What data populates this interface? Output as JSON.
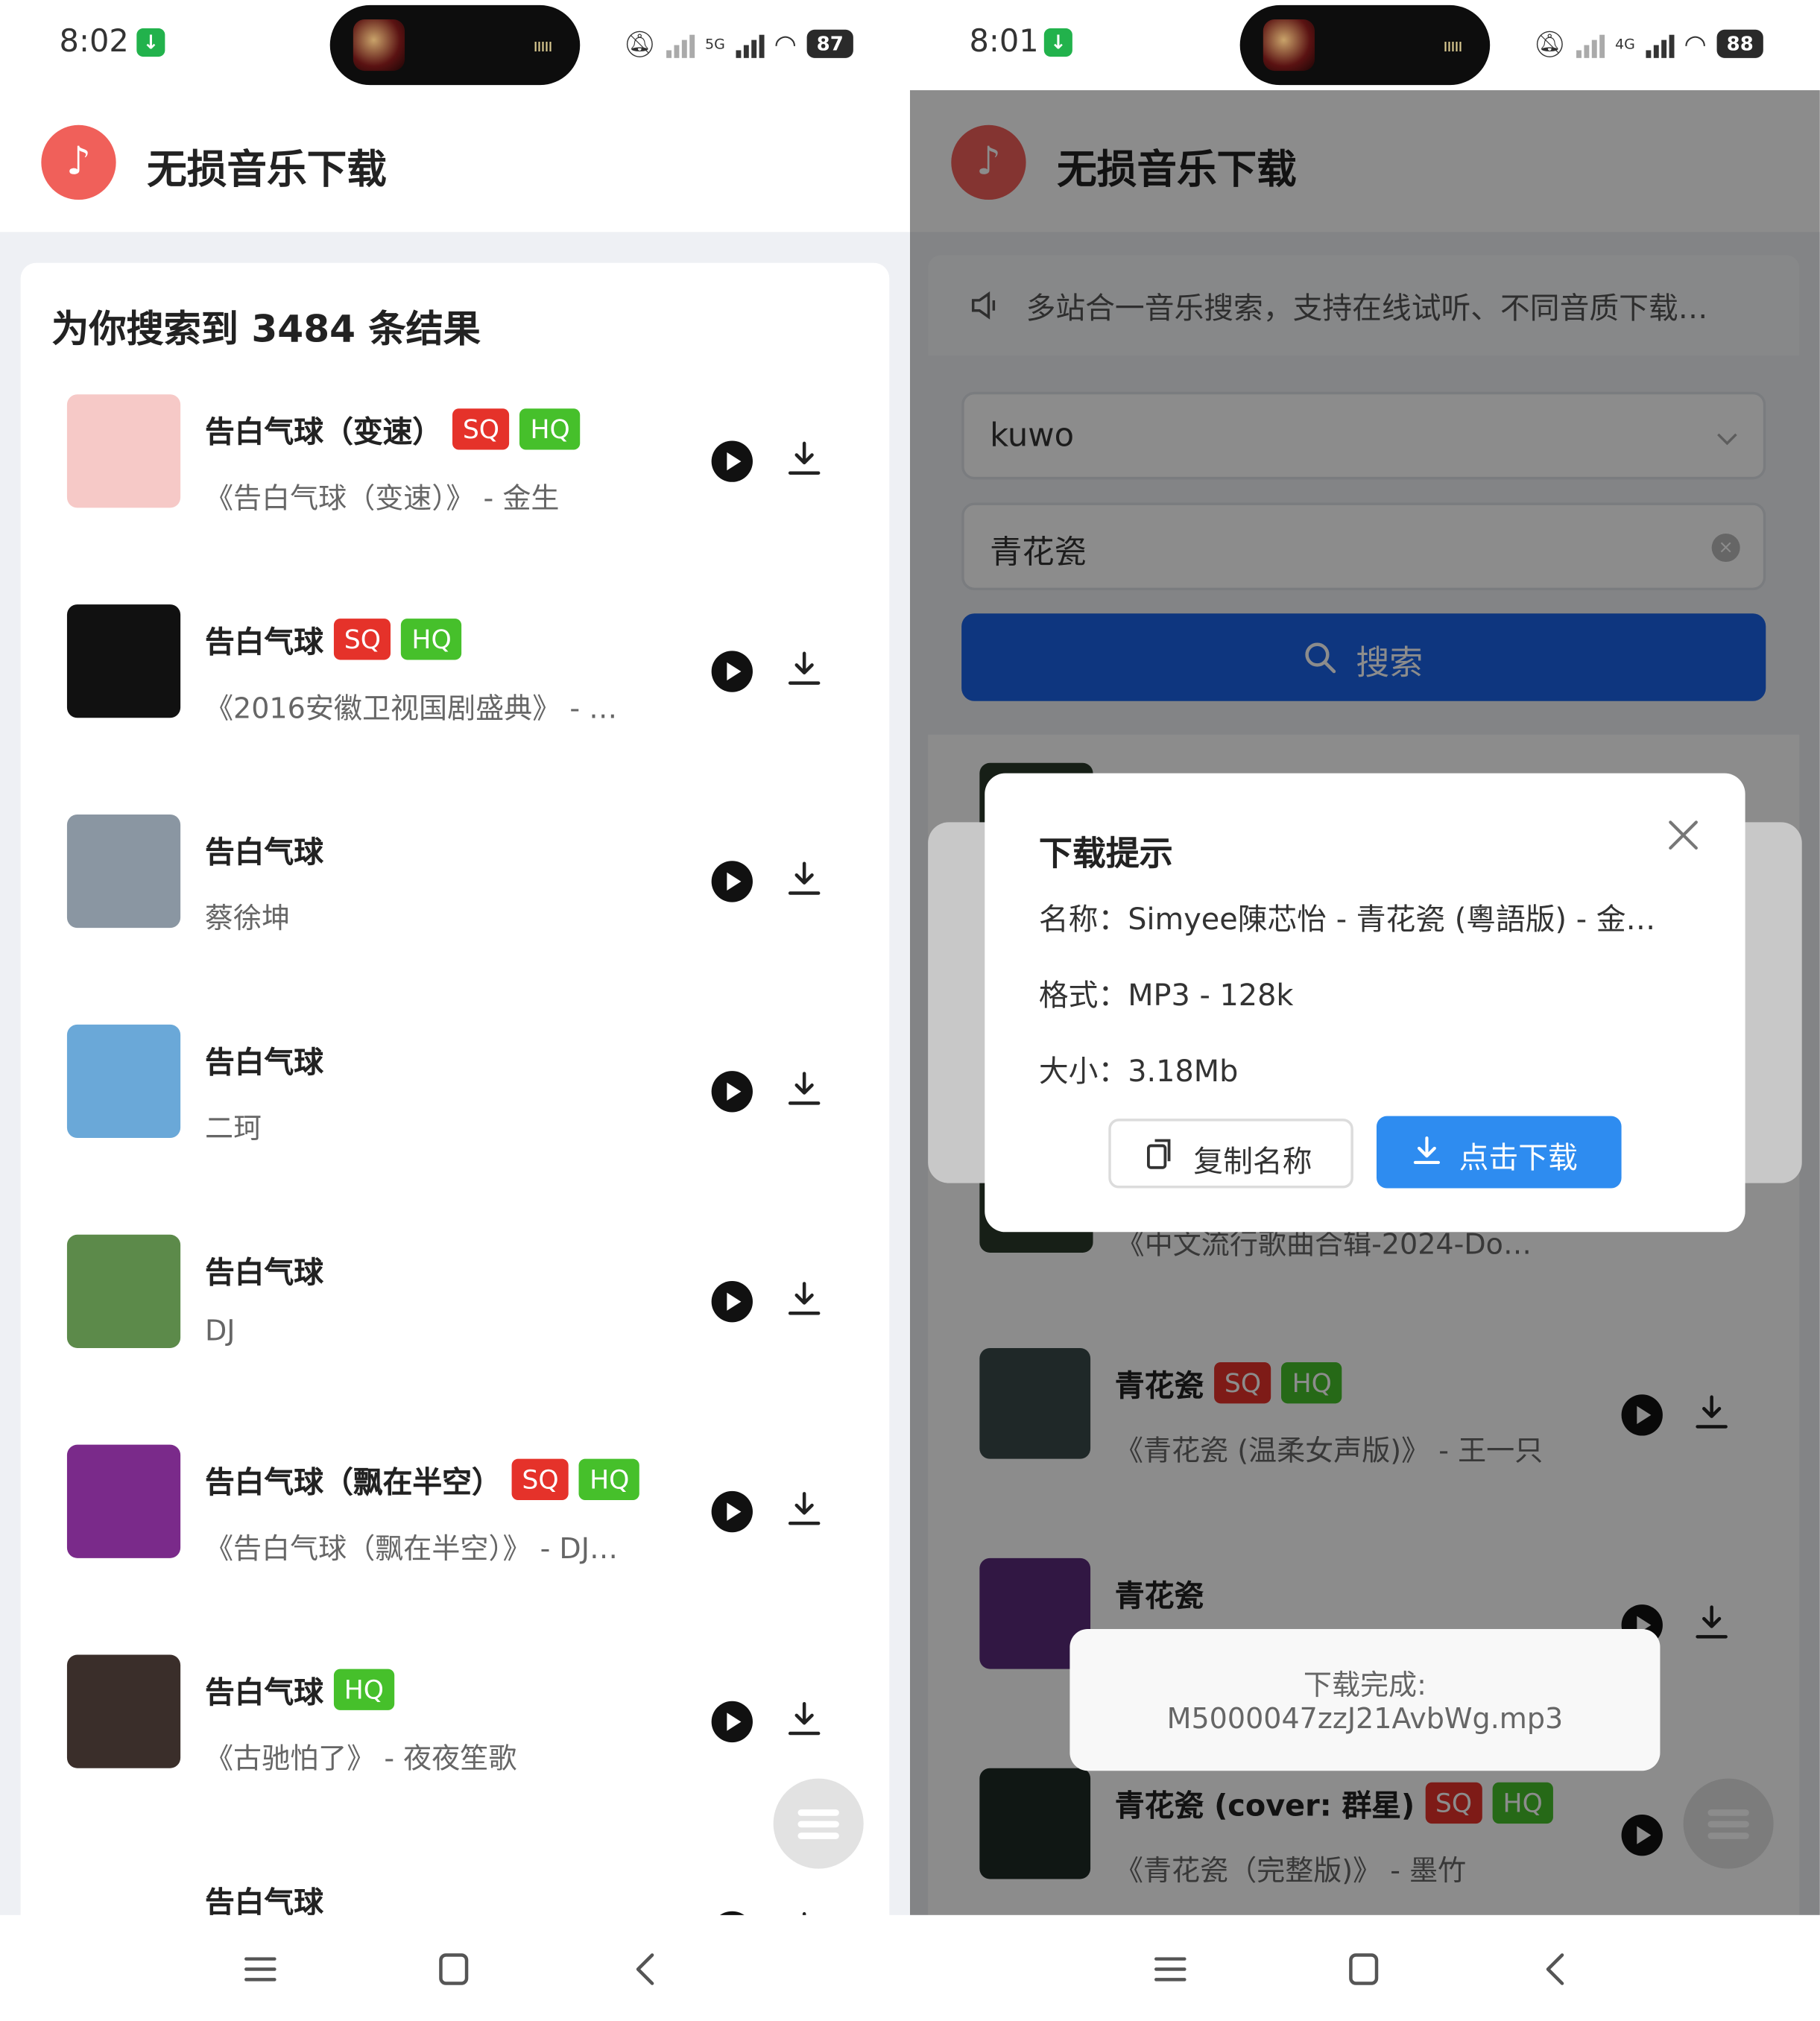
{
  "left": {
    "status": {
      "time": "8:02",
      "network": "5G",
      "battery": "87"
    },
    "app_title": "无损音乐下载",
    "results_title": "为你搜索到 3484 条结果",
    "songs": [
      {
        "title": "告白气球（变速）",
        "sq": "SQ",
        "hq": "HQ",
        "subtitle": "《告白气球（变速）》 - 金生",
        "cover_color": "#f6c9c7"
      },
      {
        "title": "告白气球",
        "sq": "SQ",
        "hq": "HQ",
        "subtitle": "《2016安徽卫视国剧盛典》 - …",
        "cover_color": "#111111"
      },
      {
        "title": "告白气球",
        "sq": "",
        "hq": "",
        "subtitle": "蔡徐坤",
        "cover_color": "#8a96a2"
      },
      {
        "title": "告白气球",
        "sq": "",
        "hq": "",
        "subtitle": "二珂",
        "cover_color": "#6aa8d8"
      },
      {
        "title": "告白气球",
        "sq": "",
        "hq": "",
        "subtitle": "DJ",
        "cover_color": "#5c8a4a"
      },
      {
        "title": "告白气球（飘在半空）",
        "sq": "SQ",
        "hq": "HQ",
        "subtitle": "《告白气球（飘在半空）》 - DJ…",
        "cover_color": "#7a2a8a"
      },
      {
        "title": "告白气球",
        "sq": "",
        "hq": "HQ",
        "subtitle": "《古驰怕了》 - 夜夜笙歌",
        "cover_color": "#3a2e2a"
      },
      {
        "title": "告白气球",
        "sq": "",
        "hq": "",
        "subtitle": "",
        "cover_color": "#ffffff"
      }
    ]
  },
  "right": {
    "status": {
      "time": "8:01",
      "network": "4G",
      "battery": "88"
    },
    "app_title": "无损音乐下载",
    "notice": "多站合一音乐搜索，支持在线试听、不同音质下载…",
    "source_select": "kuwo",
    "search_value": "青花瓷",
    "search_button": "搜索",
    "partial_subtitle": "《中文流行歌曲合辑-2024-Do…",
    "songs": [
      {
        "title": "青花瓷",
        "sq": "SQ",
        "hq": "HQ",
        "subtitle": "《青花瓷 (温柔女声版)》 - 王一只",
        "cover_color": "#3a4a4a"
      },
      {
        "title": "青花瓷",
        "sq": "",
        "hq": "",
        "subtitle": "",
        "cover_color": "#5a2a7a"
      },
      {
        "title": "青花瓷 (cover: 群星)",
        "sq": "SQ",
        "hq": "HQ",
        "subtitle": "《青花瓷（完整版)》 - 墨竹",
        "cover_color": "#1e2a26"
      }
    ],
    "dialog": {
      "title": "下载提示",
      "name_line": "名称：Simyee陳芯怡 - 青花瓷 (粵語版) - 金…",
      "format_line": "格式：MP3 - 128k",
      "size_line": "大小：3.18Mb",
      "copy_button": "复制名称",
      "download_button": "点击下载"
    },
    "toast": {
      "line1": "下载完成:",
      "line2": "M5000047zzJ21AvbWg.mp3"
    }
  },
  "colors": {
    "sq_tag": "#e5322a",
    "hq_tag": "#46c02b",
    "search_button": "#1a63e8",
    "download_button": "#2e8cf0",
    "logo": "#f0605a"
  }
}
